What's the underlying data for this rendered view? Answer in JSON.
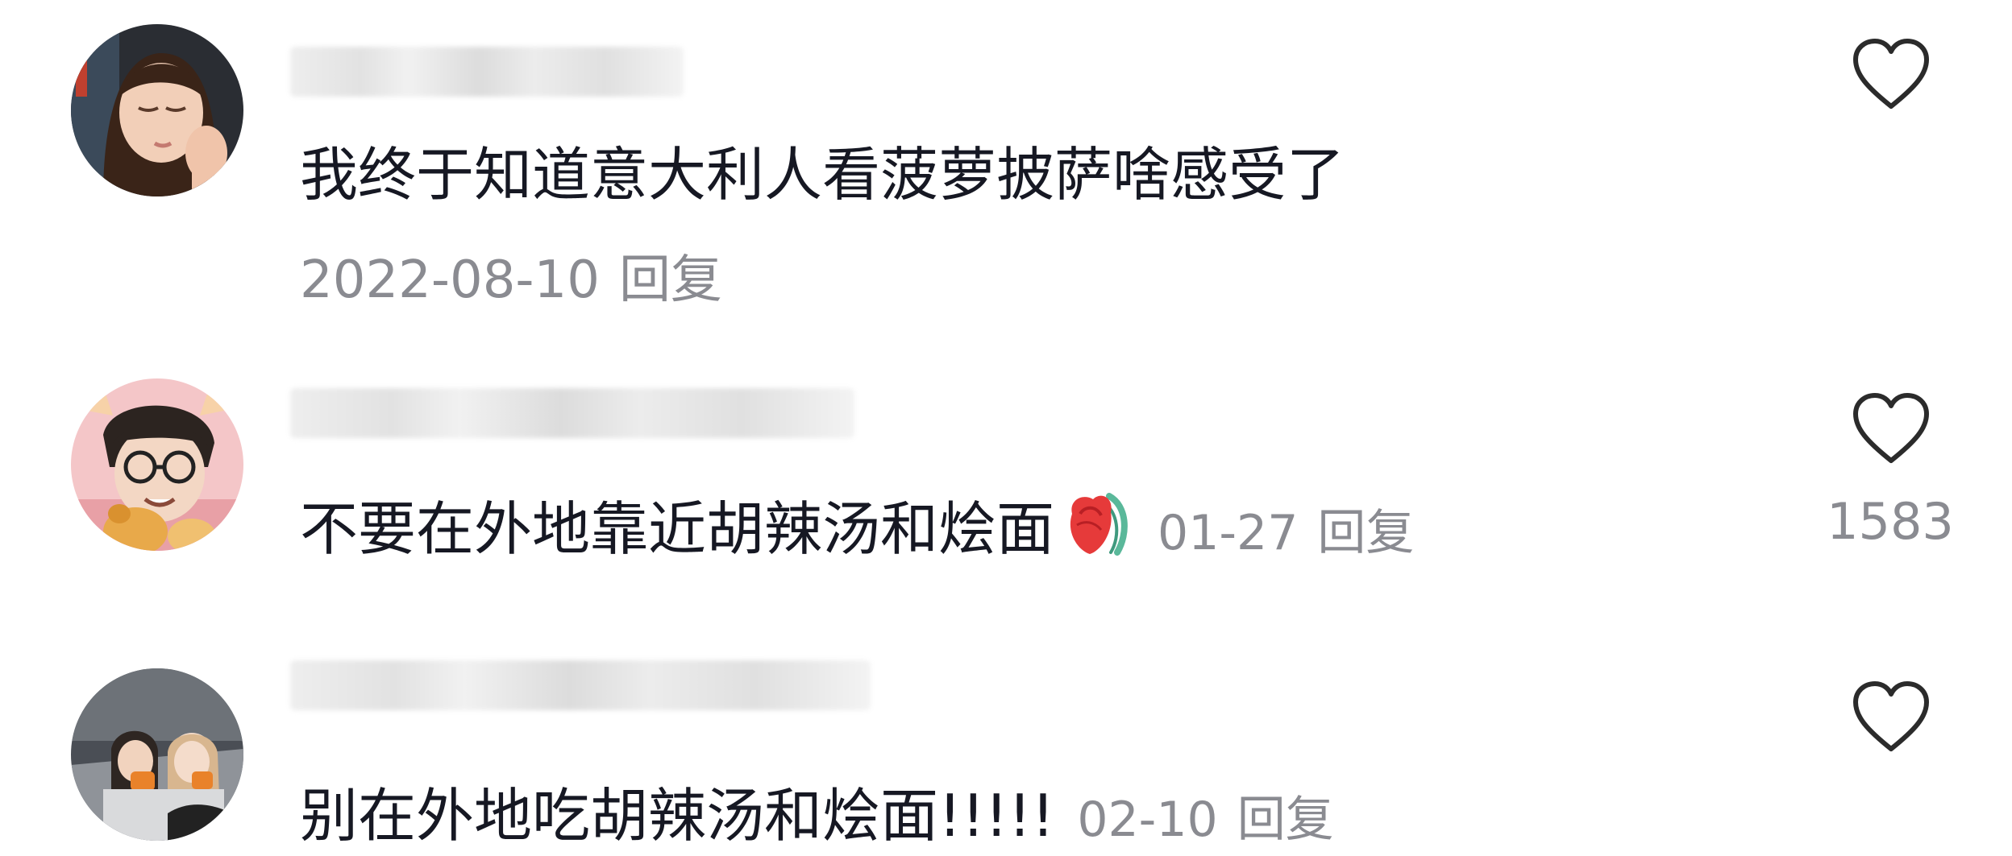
{
  "comments": [
    {
      "text": "我终于知道意大利人看菠萝披萨啥感受了",
      "date": "2022-08-10",
      "reply_label": "回复",
      "like_count": "",
      "avatar": "girl-portrait-avatar"
    },
    {
      "text": "不要在外地靠近胡辣汤和烩面",
      "date": "01-27",
      "reply_label": "回复",
      "like_count": "1583",
      "emoji": "rose-emoji",
      "avatar": "cartoon-boy-glasses-avatar"
    },
    {
      "text": "别在外地吃胡辣汤和烩面!!!!!",
      "date": "02-10",
      "reply_label": "回复",
      "like_count": "",
      "avatar": "car-selfie-avatar"
    }
  ],
  "colors": {
    "text": "#161823",
    "meta": "#8a8b91",
    "heart_outline": "#2b2b2b",
    "rose": "#e63a3a",
    "leaf": "#5ab89a"
  }
}
